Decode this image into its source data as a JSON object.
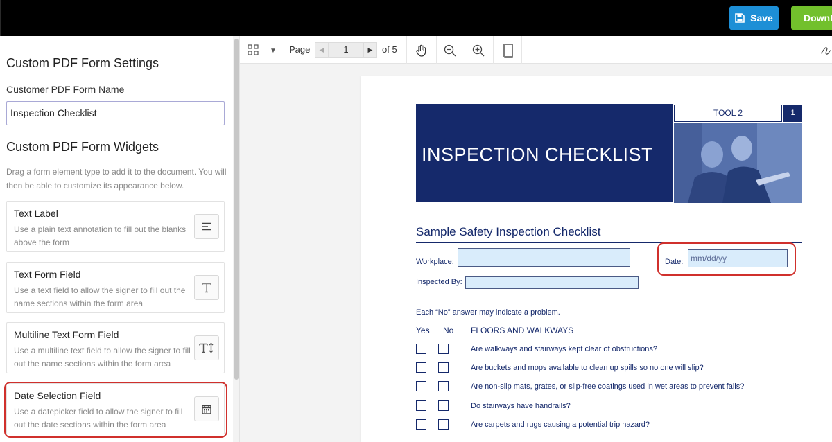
{
  "topbar": {
    "save_label": "Save",
    "download_label": "Download"
  },
  "left_panel": {
    "settings_title": "Custom PDF Form Settings",
    "form_name_label": "Customer PDF Form Name",
    "form_name_value": "Inspection Checklist",
    "widgets_title": "Custom PDF Form Widgets",
    "widgets_description": "Drag a form element type to add it to the document. You will then be able to customize its appearance below.",
    "widgets": [
      {
        "title": "Text Label",
        "description": "Use a plain text annotation to fill out the blanks above the form",
        "icon": "align-left-icon"
      },
      {
        "title": "Text Form Field",
        "description": "Use a text field to allow the signer to fill out the name sections within the form area",
        "icon": "text-t-icon"
      },
      {
        "title": "Multiline Text Form Field",
        "description": "Use a multiline text field to allow the signer to fill out the name sections within the form area",
        "icon": "text-height-icon"
      },
      {
        "title": "Date Selection Field",
        "description": "Use a datepicker field to allow the signer to fill out the date sections within the form area",
        "icon": "calendar-icon"
      }
    ]
  },
  "toolbar": {
    "page_label": "Page",
    "current_page": "1",
    "total_pages_label": "of 5"
  },
  "document": {
    "banner_title": "INSPECTION CHECKLIST",
    "tool_label": "TOOL 2",
    "tool_number": "1",
    "subtitle": "Sample Safety Inspection Checklist",
    "workplace_label": "Workplace:",
    "date_label": "Date:",
    "date_placeholder": "mm/dd/yy",
    "inspected_by_label": "Inspected By:",
    "note": "Each “No” answer may indicate a problem.",
    "col_yes": "Yes",
    "col_no": "No",
    "section_title": "FLOORS AND WALKWAYS",
    "questions": [
      "Are walkways and stairways kept clear of obstructions?",
      "Are buckets and mops available to clean up spills so no one will slip?",
      "Are non-slip mats, grates, or slip-free coatings used in wet areas to prevent falls?",
      "Do stairways have handrails?",
      "Are carpets and rugs causing a potential trip hazard?"
    ]
  },
  "colors": {
    "save": "#1d8fd6",
    "download": "#72c02c",
    "doc_navy": "#15296b",
    "highlight": "#d0302c",
    "field_fill": "#d9ecfb"
  }
}
